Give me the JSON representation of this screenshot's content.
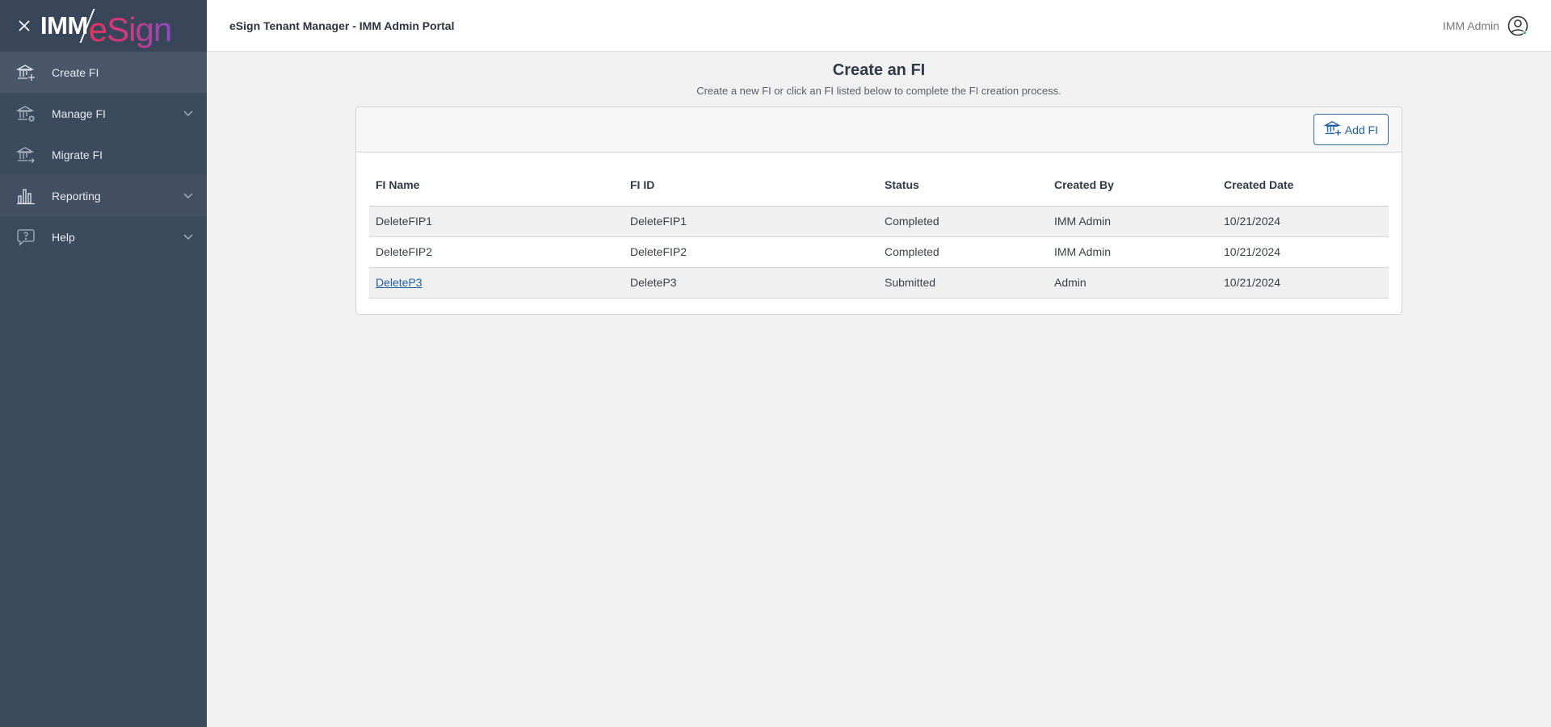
{
  "brand": {
    "logo_prefix": "IMM",
    "logo_suffix": "eSign"
  },
  "sidebar": {
    "items": [
      {
        "label": "Create FI",
        "icon": "bank-plus-icon"
      },
      {
        "label": "Manage FI",
        "icon": "bank-gear-icon"
      },
      {
        "label": "Migrate FI",
        "icon": "bank-arrow-icon"
      },
      {
        "label": "Reporting",
        "icon": "bar-chart-icon"
      },
      {
        "label": "Help",
        "icon": "help-bubble-icon"
      }
    ]
  },
  "header": {
    "title": "eSign Tenant Manager - IMM Admin Portal",
    "user_name": "IMM Admin"
  },
  "page": {
    "title": "Create an FI",
    "subtitle": "Create a new FI or click an FI listed below to complete the FI creation process."
  },
  "toolbar": {
    "add_label": "Add FI"
  },
  "table": {
    "columns": [
      "FI Name",
      "FI ID",
      "Status",
      "Created By",
      "Created Date"
    ],
    "rows": [
      {
        "name": "DeleteFIP1",
        "id": "DeleteFIP1",
        "status": "Completed",
        "created_by": "IMM Admin",
        "created_date": "10/21/2024"
      },
      {
        "name": "DeleteFIP2",
        "id": "DeleteFIP2",
        "status": "Completed",
        "created_by": "IMM Admin",
        "created_date": "10/21/2024"
      },
      {
        "name": "DeleteP3",
        "id": "DeleteP3",
        "status": "Submitted",
        "created_by": "Admin",
        "created_date": "10/21/2024"
      }
    ]
  },
  "colors": {
    "sidebar": "#3c4a5e",
    "accent": "#1f5f9e",
    "logo_gradient_start": "#e8345d",
    "logo_gradient_end": "#8e4bc2"
  }
}
